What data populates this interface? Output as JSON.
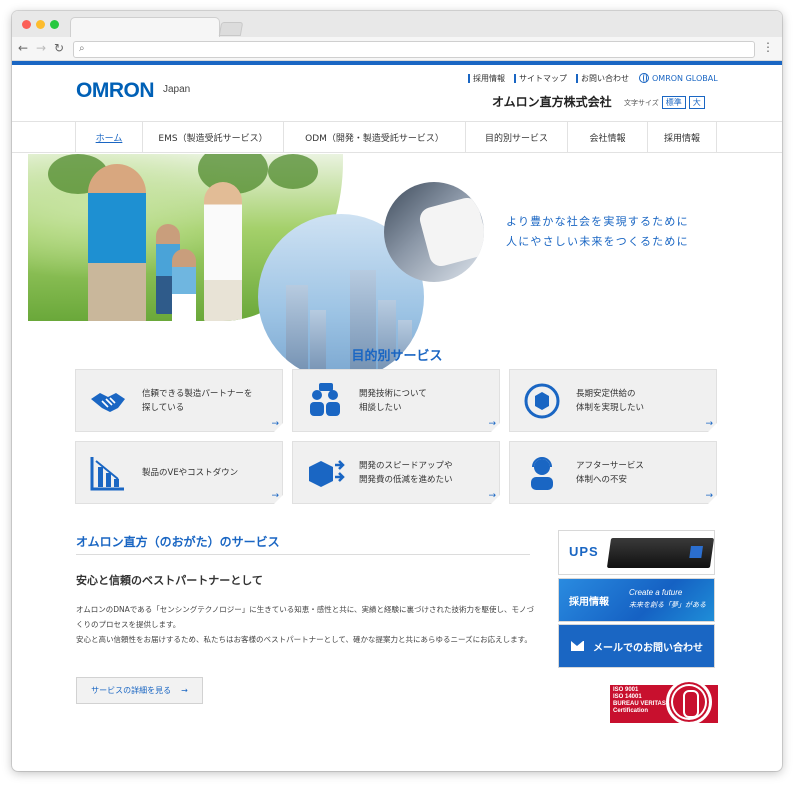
{
  "browser": {
    "url": "",
    "url_placeholder": ""
  },
  "header": {
    "logo": "OMRON",
    "logo_region": "Japan",
    "util_links": [
      "採用情報",
      "サイトマップ",
      "お問い合わせ"
    ],
    "global_link": "OMRON GLOBAL",
    "company_name": "オムロン直方株式会社",
    "font_size_label": "文字サイズ",
    "font_size_normal": "標準",
    "font_size_large": "大"
  },
  "nav": {
    "items": [
      "ホーム",
      "EMS（製造受託サービス）",
      "ODM（開発・製造受託サービス）",
      "目的別サービス",
      "会社情報",
      "採用情報"
    ]
  },
  "hero": {
    "tagline_line1": "より豊かな社会を実現するために",
    "tagline_line2": "人にやさしい未来をつくるために"
  },
  "services": {
    "title": "目的別サービス",
    "cards": [
      {
        "label": "信頼できる製造パートナーを\n探している",
        "icon": "handshake-icon"
      },
      {
        "label": "開発技術について\n相談したい",
        "icon": "consultation-icon"
      },
      {
        "label": "長期安定供給の\n体制を実現したい",
        "icon": "cycle-icon"
      },
      {
        "label": "製品のVEやコストダウン",
        "icon": "cost-down-chart-icon"
      },
      {
        "label": "開発のスピードアップや\n開発費の低減を進めたい",
        "icon": "speed-up-icon"
      },
      {
        "label": "アフターサービス\n体制への不安",
        "icon": "support-operator-icon"
      }
    ]
  },
  "about": {
    "title": "オムロン直方（のおがた）のサービス",
    "subtitle": "安心と信頼のベストパートナーとして",
    "body1": "オムロンのDNAである「センシングテクノロジー」に生きている知恵・感性と共に、実績と経験に裏づけされた技術力を駆使し、モノづくりのプロセスを提供します。",
    "body2": "安心と高い信頼性をお届けするため、私たちはお客様のベストパートナーとして、確かな提案力と共にあらゆるニーズにお応えします。",
    "button": "サービスの詳細を見る"
  },
  "side": {
    "ups": "UPS",
    "recruit": "採用情報",
    "recruit_sub1": "Create a future",
    "recruit_sub2": "未来を創る「夢」がある",
    "mail": "メールでのお問い合わせ",
    "cert_text": "ISO 9001\nISO 14001\nBUREAU VERITAS\nCertification"
  },
  "colors": {
    "brand_blue": "#1a66c3",
    "cert_red": "#c8102e"
  }
}
